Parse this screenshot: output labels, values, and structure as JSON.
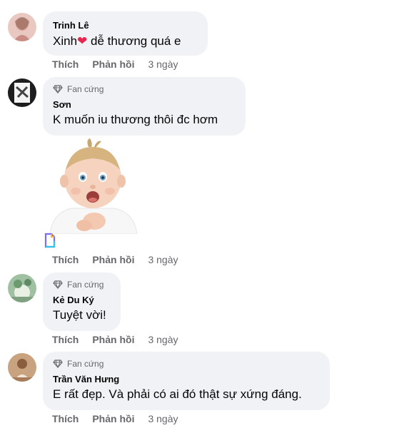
{
  "comments": [
    {
      "name": "Trinh Lê",
      "badge": "",
      "text_before": "Xinh",
      "text_emoji": "❤",
      "text_after": " dễ thương quá e",
      "like": "Thích",
      "reply": "Phản hồi",
      "time": "3 ngày"
    },
    {
      "name": "Sơn",
      "badge": "Fan cứng",
      "text": "K muốn iu thương thôi đc hơm",
      "like": "Thích",
      "reply": "Phản hồi",
      "time": "3 ngày"
    },
    {
      "name": "Kẻ Du Ký",
      "badge": "Fan cứng",
      "text": "Tuyệt vời!",
      "like": "Thích",
      "reply": "Phản hồi",
      "time": "3 ngày"
    },
    {
      "name": "Trần Văn Hưng",
      "badge": "Fan cứng",
      "text": "E rất đẹp. Và phải có ai đó thật sự xứng đáng.",
      "like": "Thích",
      "reply": "Phản hồi",
      "time": "3 ngày"
    }
  ],
  "colors": {
    "bubble": "#f0f2f5",
    "muted": "#65676b",
    "text": "#050505",
    "heart": "#e8254d"
  },
  "icons": {
    "badge": "diamond-icon",
    "sticker": "baby-sticker",
    "sticker_mark": "document-icon"
  }
}
